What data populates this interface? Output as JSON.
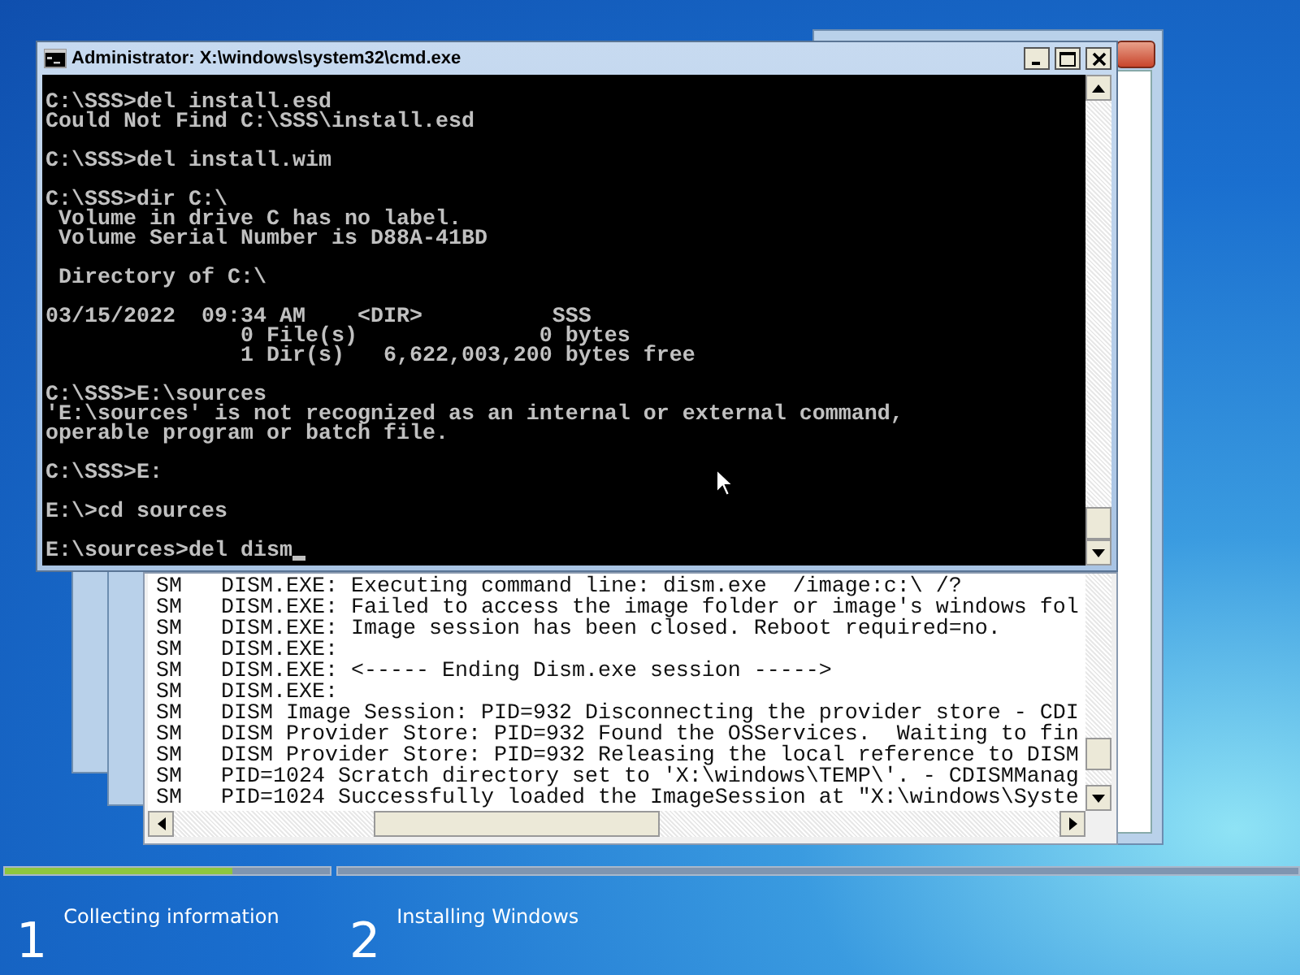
{
  "console_window": {
    "title": "Administrator: X:\\windows\\system32\\cmd.exe",
    "blocks": [
      [
        "C:\\SSS>del install.esd",
        "Could Not Find C:\\SSS\\install.esd"
      ],
      [
        "C:\\SSS>del install.wim"
      ],
      [
        "C:\\SSS>dir C:\\",
        " Volume in drive C has no label.",
        " Volume Serial Number is D88A-41BD"
      ],
      [
        " Directory of C:\\"
      ],
      [
        "03/15/2022  09:34 AM    <DIR>          SSS",
        "               0 File(s)              0 bytes",
        "               1 Dir(s)   6,622,003,200 bytes free"
      ],
      [
        "C:\\SSS>E:\\sources",
        "'E:\\sources' is not recognized as an internal or external command,",
        "operable program or batch file."
      ],
      [
        "C:\\SSS>E:"
      ],
      [
        "E:\\>cd sources"
      ],
      [
        "E:\\sources>del dism"
      ]
    ]
  },
  "log_window": {
    "lines": [
      {
        "prefix": "SM",
        "text": "DISM.EXE: Executing command line: dism.exe  /image:c:\\ /?"
      },
      {
        "prefix": "SM",
        "text": "DISM.EXE: Failed to access the image folder or image's windows fol"
      },
      {
        "prefix": "SM",
        "text": "DISM.EXE: Image session has been closed. Reboot required=no."
      },
      {
        "prefix": "SM",
        "text": "DISM.EXE:"
      },
      {
        "prefix": "SM",
        "text": "DISM.EXE: <----- Ending Dism.exe session ----->"
      },
      {
        "prefix": "SM",
        "text": "DISM.EXE:"
      },
      {
        "prefix": "SM",
        "text": "DISM Image Session: PID=932 Disconnecting the provider store - CDI"
      },
      {
        "prefix": "SM",
        "text": "DISM Provider Store: PID=932 Found the OSServices.  Waiting to fin"
      },
      {
        "prefix": "SM",
        "text": "DISM Provider Store: PID=932 Releasing the local reference to DISM"
      },
      {
        "prefix": "SM",
        "text": "PID=1024 Scratch directory set to 'X:\\windows\\TEMP\\'. - CDISMManag"
      },
      {
        "prefix": "SM",
        "text": "PID=1024 Successfully loaded the ImageSession at \"X:\\windows\\Syste"
      }
    ]
  },
  "setup_steps": [
    {
      "number": "1",
      "label": "Collecting information",
      "level": 0.7
    },
    {
      "number": "2",
      "label": "Installing Windows"
    }
  ]
}
